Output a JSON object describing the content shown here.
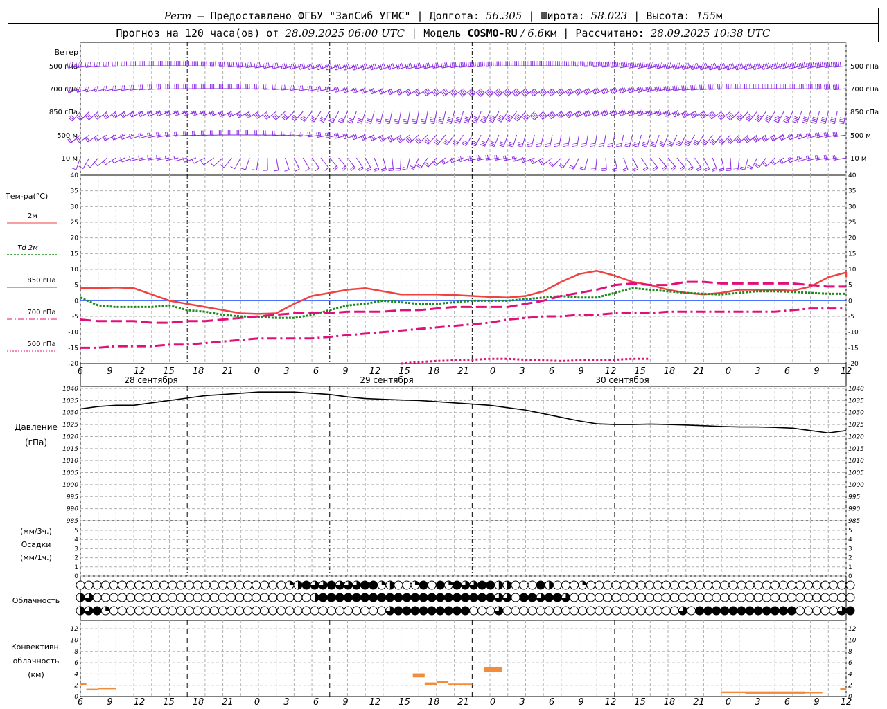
{
  "header": {
    "station": "Perm",
    "dash": " — ",
    "provider": "Предоставлено ФГБУ \"ЗапСиб УГМС\"",
    "sep": " | ",
    "lon_label": "Долгота: ",
    "lon_value": "56.305",
    "lat_label": "Широта: ",
    "lat_value": "58.023",
    "alt_label": "Высота: ",
    "alt_value": "155",
    "alt_unit": "м",
    "forecast_prefix": "Прогноз на 120 часа(ов) от ",
    "forecast_time": "28.09.2025 06:00 UTC",
    "model_label": "Модель ",
    "model_name": "COSMO-RU",
    "model_res": " / 6.6",
    "model_unit": "км",
    "calc_label": "Рассчитано: ",
    "calc_time": "28.09.2025 10:38 UTC"
  },
  "time_axis": {
    "hour_labels": [
      "6",
      "9",
      "12",
      "15",
      "18",
      "21",
      "0",
      "3",
      "6",
      "9",
      "12",
      "15",
      "18",
      "21",
      "0",
      "3",
      "6",
      "9",
      "12",
      "15",
      "18",
      "21",
      "0",
      "3",
      "6",
      "9",
      "12"
    ],
    "date_labels": [
      "28 сентября",
      "29 сентября",
      "30 сентября"
    ]
  },
  "wind_panel": {
    "title": "Ветер",
    "levels": [
      "500 гПа",
      "700 гПа",
      "850 гПа",
      "500 м",
      "10 м"
    ],
    "barb_color": "#8a2be2"
  },
  "temp_panel": {
    "title": "Тем-ра(°С)",
    "legend": [
      "2м",
      "Td 2м",
      "850 гПа",
      "700 гПа",
      "500 гПа"
    ],
    "ticks": [
      "40",
      "35",
      "30",
      "25",
      "20",
      "15",
      "10",
      "5",
      "0",
      "-5",
      "-10",
      "-15",
      "-20"
    ]
  },
  "pressure_panel": {
    "title1": "Давление",
    "title2": "(гПа)",
    "ticks": [
      "1040",
      "1035",
      "1030",
      "1025",
      "1020",
      "1015",
      "1010",
      "1005",
      "1000",
      "995",
      "990",
      "985"
    ]
  },
  "precip_panel": {
    "label1": "(мм/3ч.)",
    "label2": "Осадки",
    "label3": "(мм/1ч.)",
    "ticks": [
      "5",
      "4",
      "3",
      "2",
      "1",
      "0"
    ]
  },
  "cloud_panel": {
    "title": "Облачность"
  },
  "conv_panel": {
    "title1": "Конвективн.",
    "title2": "облачность",
    "title3": "(км)",
    "ticks": [
      "12",
      "10",
      "8",
      "6",
      "4",
      "2",
      "0"
    ],
    "color": "#f08c3c"
  },
  "colors": {
    "t2m": "#f04040",
    "td2m": "#1a8a1a",
    "t850": "#e0107a",
    "t700": "#e0107a",
    "t500": "#e0107a",
    "pressure": "#000000"
  },
  "chart_data": [
    {
      "type": "line",
      "title": "Тем-ра(°С)",
      "x_hours": [
        0,
        3,
        6,
        9,
        12,
        15,
        18,
        21,
        24,
        27,
        30,
        33,
        36,
        39,
        42,
        45,
        48,
        51,
        54,
        57,
        60,
        63,
        66,
        69,
        72,
        75,
        78,
        81,
        84,
        87,
        90,
        93,
        96,
        99,
        102,
        105,
        108,
        111,
        114,
        117,
        120,
        123,
        126,
        129
      ],
      "ylim": [
        -20,
        40
      ],
      "series": [
        {
          "name": "2м",
          "values": [
            4,
            4,
            4.2,
            4,
            2,
            0,
            -1,
            -2,
            -3,
            -4,
            -4.2,
            -4,
            -1,
            1.5,
            2.5,
            3.5,
            4,
            3,
            2,
            2,
            2,
            1.8,
            1.5,
            1.2,
            1,
            1.5,
            3,
            6,
            8.5,
            9.5,
            8,
            6,
            5,
            3.5,
            2.5,
            2,
            2.5,
            3.5,
            3.5,
            3.5,
            3.2,
            4.5,
            7.5,
            9
          ],
          "tail": 7.5
        },
        {
          "name": "Td 2м",
          "values": [
            1,
            -1.5,
            -2,
            -2,
            -2,
            -1.5,
            -3,
            -3.5,
            -4.5,
            -5,
            -5.2,
            -5.5,
            -5.5,
            -4.5,
            -3,
            -1.5,
            -1,
            0,
            -0.5,
            -1,
            -1,
            -0.5,
            0,
            0,
            0,
            0.5,
            1,
            1.5,
            1,
            1,
            2.5,
            4,
            3.5,
            3,
            2.5,
            2.2,
            2,
            2.5,
            3,
            3,
            2.8,
            2.5,
            2.2,
            2.2
          ]
        },
        {
          "name": "850 гПа",
          "values": [
            -6,
            -6.5,
            -6.5,
            -6.5,
            -7,
            -7,
            -6.5,
            -6.5,
            -6,
            -5.5,
            -5,
            -4.5,
            -4,
            -4,
            -4,
            -3.5,
            -3.5,
            -3.5,
            -3,
            -3,
            -2.5,
            -2,
            -2,
            -2,
            -2,
            -1,
            0,
            1.5,
            2.5,
            3.5,
            5,
            5.5,
            5,
            5,
            6,
            6,
            5.5,
            5.5,
            5.5,
            5.5,
            5.5,
            5,
            4.5,
            4.5
          ]
        },
        {
          "name": "700 гПа",
          "values": [
            -15,
            -15,
            -14.5,
            -14.5,
            -14.5,
            -14,
            -14,
            -13.5,
            -13,
            -12.5,
            -12,
            -12,
            -12,
            -12,
            -11.5,
            -11,
            -10.5,
            -10,
            -9.5,
            -9,
            -8.5,
            -8,
            -7.5,
            -7,
            -6,
            -5.5,
            -5,
            -5,
            -4.5,
            -4.5,
            -4,
            -4,
            -4,
            -3.5,
            -3.5,
            -3.5,
            -3.5,
            -3.5,
            -3.5,
            -3.5,
            -3,
            -2.5,
            -2.5,
            -2.5
          ]
        },
        {
          "name": "500 гПа",
          "x_from": 54,
          "values": [
            -20,
            -19.5,
            -19.2,
            -19,
            -18.8,
            -18.5,
            -18.5,
            -18.8,
            -19,
            -19.2,
            -19,
            -19,
            -18.8,
            -18.5,
            -18.5
          ]
        }
      ]
    },
    {
      "type": "line",
      "title": "Давление",
      "x_hours": [
        0,
        3,
        6,
        9,
        12,
        15,
        18,
        21,
        24,
        27,
        30,
        33,
        36,
        39,
        42,
        45,
        48,
        51,
        54,
        57,
        60,
        63,
        66,
        69,
        72,
        75,
        78,
        81,
        84,
        87,
        90,
        93,
        96,
        99,
        102,
        105,
        108,
        111,
        114,
        117,
        120,
        123,
        126,
        129
      ],
      "ylim": [
        985,
        1040
      ],
      "series": [
        {
          "name": "Давление",
          "values": [
            1031.5,
            1032.5,
            1033,
            1033,
            1034,
            1035,
            1036,
            1037,
            1037.5,
            1038,
            1038.5,
            1038.5,
            1038.5,
            1038,
            1037.5,
            1036.5,
            1035.8,
            1035.5,
            1035.2,
            1035,
            1034.5,
            1034,
            1033.5,
            1033,
            1032,
            1031,
            1029.5,
            1028,
            1026.5,
            1025.3,
            1025,
            1025,
            1025.2,
            1025,
            1024.8,
            1024.5,
            1024.2,
            1024,
            1024,
            1023.8,
            1023.5,
            1022.5,
            1021.5,
            1022.5
          ]
        }
      ]
    },
    {
      "type": "bar",
      "title": "Конвективн. облачность (км)",
      "ylim": [
        0,
        13
      ],
      "segments": [
        {
          "x0": 0,
          "x1": 1,
          "bottom": 2,
          "top": 2.4
        },
        {
          "x0": 1,
          "x1": 3,
          "bottom": 1.1,
          "top": 1.4
        },
        {
          "x0": 3,
          "x1": 6,
          "bottom": 1.3,
          "top": 1.6
        },
        {
          "x0": 56,
          "x1": 58,
          "bottom": 3.4,
          "top": 4.1
        },
        {
          "x0": 58,
          "x1": 60,
          "bottom": 2,
          "top": 2.5
        },
        {
          "x0": 60,
          "x1": 62,
          "bottom": 2.4,
          "top": 2.8
        },
        {
          "x0": 62,
          "x1": 66,
          "bottom": 2,
          "top": 2.3
        },
        {
          "x0": 68,
          "x1": 71,
          "bottom": 4.4,
          "top": 5.2
        },
        {
          "x0": 108,
          "x1": 112,
          "bottom": 0.6,
          "top": 0.9
        },
        {
          "x0": 112,
          "x1": 122,
          "bottom": 0.5,
          "top": 0.9
        },
        {
          "x0": 122,
          "x1": 125,
          "bottom": 0.6,
          "top": 0.8
        },
        {
          "x0": 128,
          "x1": 129,
          "bottom": 1.1,
          "top": 1.5
        }
      ]
    }
  ],
  "cloud_data": {
    "low": "000000000000000000000000012433433344120014041433442200042000100000000000000000000000000000000",
    "mid": "230000000000000000000000000024444444444444444444443304434430000000000000000000000000000000000",
    "high": "234100000000000000000000000000000000034444444440003000000000000000000000304444444444440000034"
  }
}
